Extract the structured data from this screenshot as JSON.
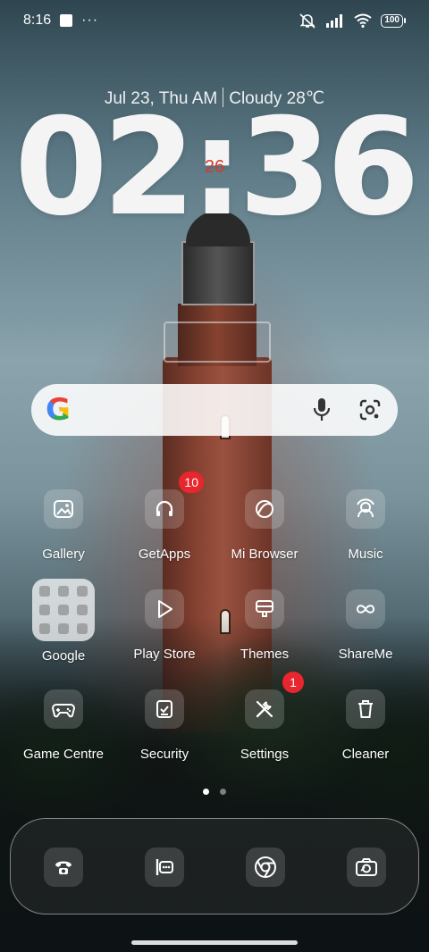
{
  "status_bar": {
    "time": "8:16",
    "notif_icons": [
      "screen-icon",
      "more-dots-icon"
    ],
    "dots": "···",
    "right_icons": [
      "silent-bell-icon",
      "signal-icon",
      "wifi-icon",
      "battery-icon"
    ],
    "battery": "100"
  },
  "clock_widget": {
    "date": "Jul 23, Thu AM",
    "weather": "Cloudy 28℃",
    "time": "02:36",
    "seconds": "26"
  },
  "search_bar": {
    "logo": "G",
    "icons": [
      "microphone-icon",
      "google-lens-icon"
    ]
  },
  "apps": [
    {
      "label": "Gallery",
      "icon": "gallery-icon"
    },
    {
      "label": "GetApps",
      "icon": "getapps-icon",
      "badge": "10"
    },
    {
      "label": "Mi Browser",
      "icon": "browser-icon"
    },
    {
      "label": "Music",
      "icon": "music-icon"
    },
    {
      "label": "Google",
      "icon": "folder-icon"
    },
    {
      "label": "Play Store",
      "icon": "play-store-icon"
    },
    {
      "label": "Themes",
      "icon": "themes-icon"
    },
    {
      "label": "ShareMe",
      "icon": "shareme-icon"
    },
    {
      "label": "Game Centre",
      "icon": "gamepad-icon"
    },
    {
      "label": "Security",
      "icon": "security-icon"
    },
    {
      "label": "Settings",
      "icon": "settings-icon",
      "badge": "1"
    },
    {
      "label": "Cleaner",
      "icon": "trash-icon"
    }
  ],
  "pager": {
    "pages": 2,
    "active": 1
  },
  "dock": {
    "icons": [
      "phone-icon",
      "messages-icon",
      "chrome-icon",
      "camera-icon"
    ]
  },
  "colors": {
    "badge": "#e8262d",
    "seconds": "#d43a2f"
  }
}
